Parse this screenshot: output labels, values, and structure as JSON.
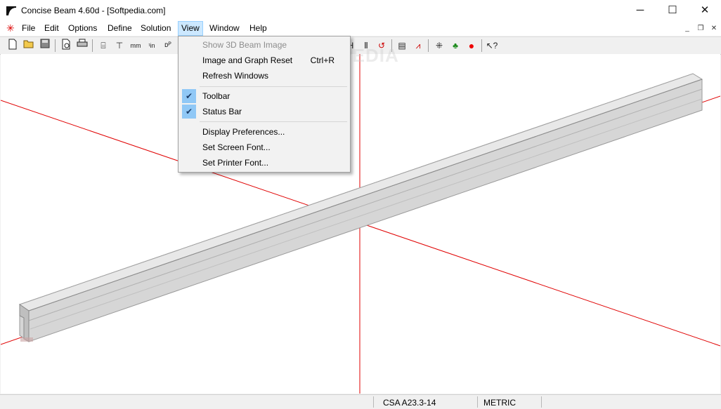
{
  "window": {
    "title": "Concise Beam 4.60d - [Softpedia.com]",
    "controls": {
      "minimize": "─",
      "maximize": "☐",
      "close": "✕"
    }
  },
  "menubar": {
    "app_icon": "red-asterisk-icon",
    "items": [
      "File",
      "Edit",
      "Options",
      "Define",
      "Solution",
      "View",
      "Window",
      "Help"
    ],
    "active": "View",
    "mdi_controls": {
      "minimize": "_",
      "restore": "❐",
      "close": "✕"
    }
  },
  "toolbar": {
    "icons": [
      "new-file-icon",
      "open-folder-icon",
      "save-icon",
      "print-preview-icon",
      "print-icon",
      "beam-section-icon",
      "beam-elevation-icon",
      "mm-in-icon",
      "in-ft-icon",
      "units-icon",
      "strand-icon",
      "girder-section-icon",
      "moment-icon",
      "report-icon",
      "graph-icon",
      "expand-icon",
      "tree-icon",
      "record-stop-icon",
      "context-help-icon"
    ],
    "glyphs": {
      "mm-in": "ᵐᵐ\nin",
      "in-ft": "ᵗᶦⁿ"
    }
  },
  "view_menu": {
    "items": [
      {
        "label": "Show 3D Beam Image",
        "disabled": true
      },
      {
        "label": "Image and Graph Reset",
        "shortcut": "Ctrl+R"
      },
      {
        "label": "Refresh Windows"
      },
      {
        "label": "Toolbar",
        "checked": true
      },
      {
        "label": "Status Bar",
        "checked": true
      },
      {
        "label": "Display Preferences..."
      },
      {
        "label": "Set Screen Font..."
      },
      {
        "label": "Set Printer Font..."
      }
    ]
  },
  "statusbar": {
    "code": "CSA A23.3-14",
    "units": "METRIC"
  },
  "watermark": "SOFTPEDIA",
  "colors": {
    "axis": "#e00000",
    "beam": "#d9d9d9",
    "menu_highlight": "#cce8ff",
    "check_bg": "#90c8f6"
  }
}
